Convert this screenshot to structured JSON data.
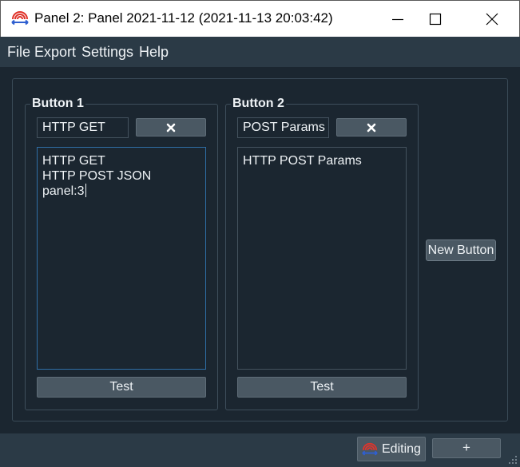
{
  "window": {
    "title": "Panel 2: Panel 2021-11-12 (2021-11-13 20:03:42)",
    "app_icon": "radio-broadcast-icon",
    "controls": [
      "minimize-icon",
      "maximize-icon",
      "close-icon"
    ]
  },
  "menu": {
    "items": [
      {
        "label": "File"
      },
      {
        "label": "Export"
      },
      {
        "label": "Settings"
      },
      {
        "label": "Help"
      }
    ]
  },
  "buttons": [
    {
      "title": "Button 1",
      "name_value": "HTTP GET",
      "delete_icon": "heavy-x-icon",
      "script_lines": [
        "HTTP GET",
        "HTTP POST JSON",
        "panel:3"
      ],
      "test_label": "Test"
    },
    {
      "title": "Button 2",
      "name_value": "POST Params",
      "delete_icon": "heavy-x-icon",
      "script_lines": [
        "HTTP POST Params"
      ],
      "test_label": "Test"
    }
  ],
  "new_button_label": "New Button",
  "status": {
    "editing_label": "Editing",
    "add_label": "+"
  },
  "colors": {
    "background": "#1b2630",
    "menubar": "#2b3a46",
    "button": "#4a5863",
    "text": "#eef2f5",
    "focus_border": "#2f6fa6",
    "icon_red": "#e0342b",
    "icon_blue": "#2f5fd0"
  }
}
